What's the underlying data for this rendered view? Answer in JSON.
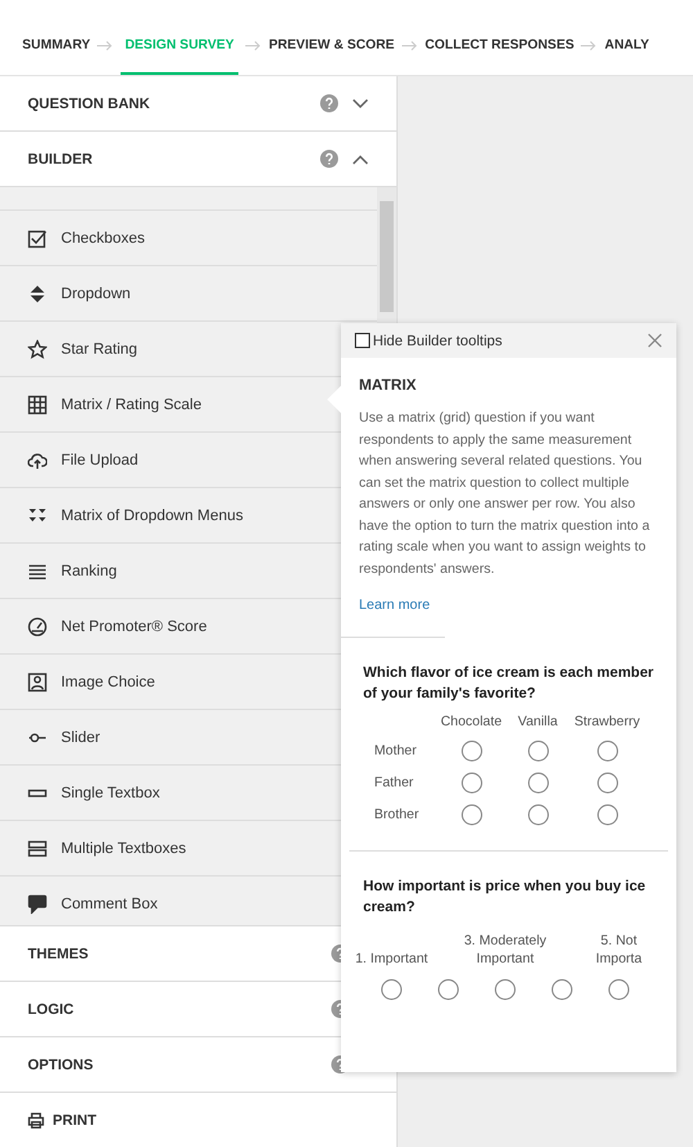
{
  "nav": {
    "steps": [
      {
        "label": "SUMMARY",
        "selected": false
      },
      {
        "label": "DESIGN SURVEY",
        "selected": true
      },
      {
        "label": "PREVIEW & SCORE",
        "selected": false
      },
      {
        "label": "COLLECT RESPONSES",
        "selected": false
      },
      {
        "label": "ANALY",
        "selected": false
      }
    ]
  },
  "question_bank": {
    "title": "QUESTION BANK",
    "expanded": false
  },
  "builder": {
    "title": "BUILDER",
    "expanded": true,
    "items": [
      {
        "label": "Checkboxes",
        "kind": "checkbox"
      },
      {
        "label": "Dropdown",
        "kind": "dropdown"
      },
      {
        "label": "Star Rating",
        "kind": "star"
      },
      {
        "label": "Matrix / Rating Scale",
        "kind": "grid"
      },
      {
        "label": "File Upload",
        "kind": "upload"
      },
      {
        "label": "Matrix of Dropdown Menus",
        "kind": "dropgrid"
      },
      {
        "label": "Ranking",
        "kind": "lines"
      },
      {
        "label": "Net Promoter® Score",
        "kind": "gauge"
      },
      {
        "label": "Image Choice",
        "kind": "image"
      },
      {
        "label": "Slider",
        "kind": "slider"
      },
      {
        "label": "Single Textbox",
        "kind": "textbox"
      },
      {
        "label": "Multiple Textboxes",
        "kind": "textboxes"
      },
      {
        "label": "Comment Box",
        "kind": "comment"
      }
    ]
  },
  "sections": [
    {
      "title": "THEMES"
    },
    {
      "title": "LOGIC"
    },
    {
      "title": "OPTIONS"
    }
  ],
  "print": {
    "label": "PRINT"
  },
  "tooltip": {
    "hide_tooltips": {
      "label": "Hide Builder tooltips",
      "checked": false
    },
    "title": "MATRIX",
    "body": "Use a matrix (grid) question if you want respondents to apply the same measurement when answering several related questions. You can set the matrix question to collect multiple answers or only one answer per row. You also have the option to turn the matrix question into a rating scale when you want to assign weights to respondents' answers.",
    "link": "Learn more",
    "matrix_example": {
      "question": "Which flavor of ice cream is each member of your family's favorite?",
      "columns": [
        "Chocolate",
        "Vanilla",
        "Strawberry"
      ],
      "rows": [
        {
          "label": "Mother",
          "selected": [
            false,
            false,
            false
          ]
        },
        {
          "label": "Father",
          "selected": [
            false,
            false,
            false
          ]
        },
        {
          "label": "Brother",
          "selected": [
            false,
            false,
            false
          ]
        }
      ]
    },
    "scale_example": {
      "question": "How important is price when you buy ice cream?",
      "options": [
        {
          "label": "1. Important",
          "selected": false
        },
        {
          "selected": false
        },
        {
          "label": "3. Moderately Important",
          "selected": false
        },
        {
          "selected": false
        },
        {
          "label": "5. Not Importa",
          "selected": false
        }
      ]
    }
  }
}
